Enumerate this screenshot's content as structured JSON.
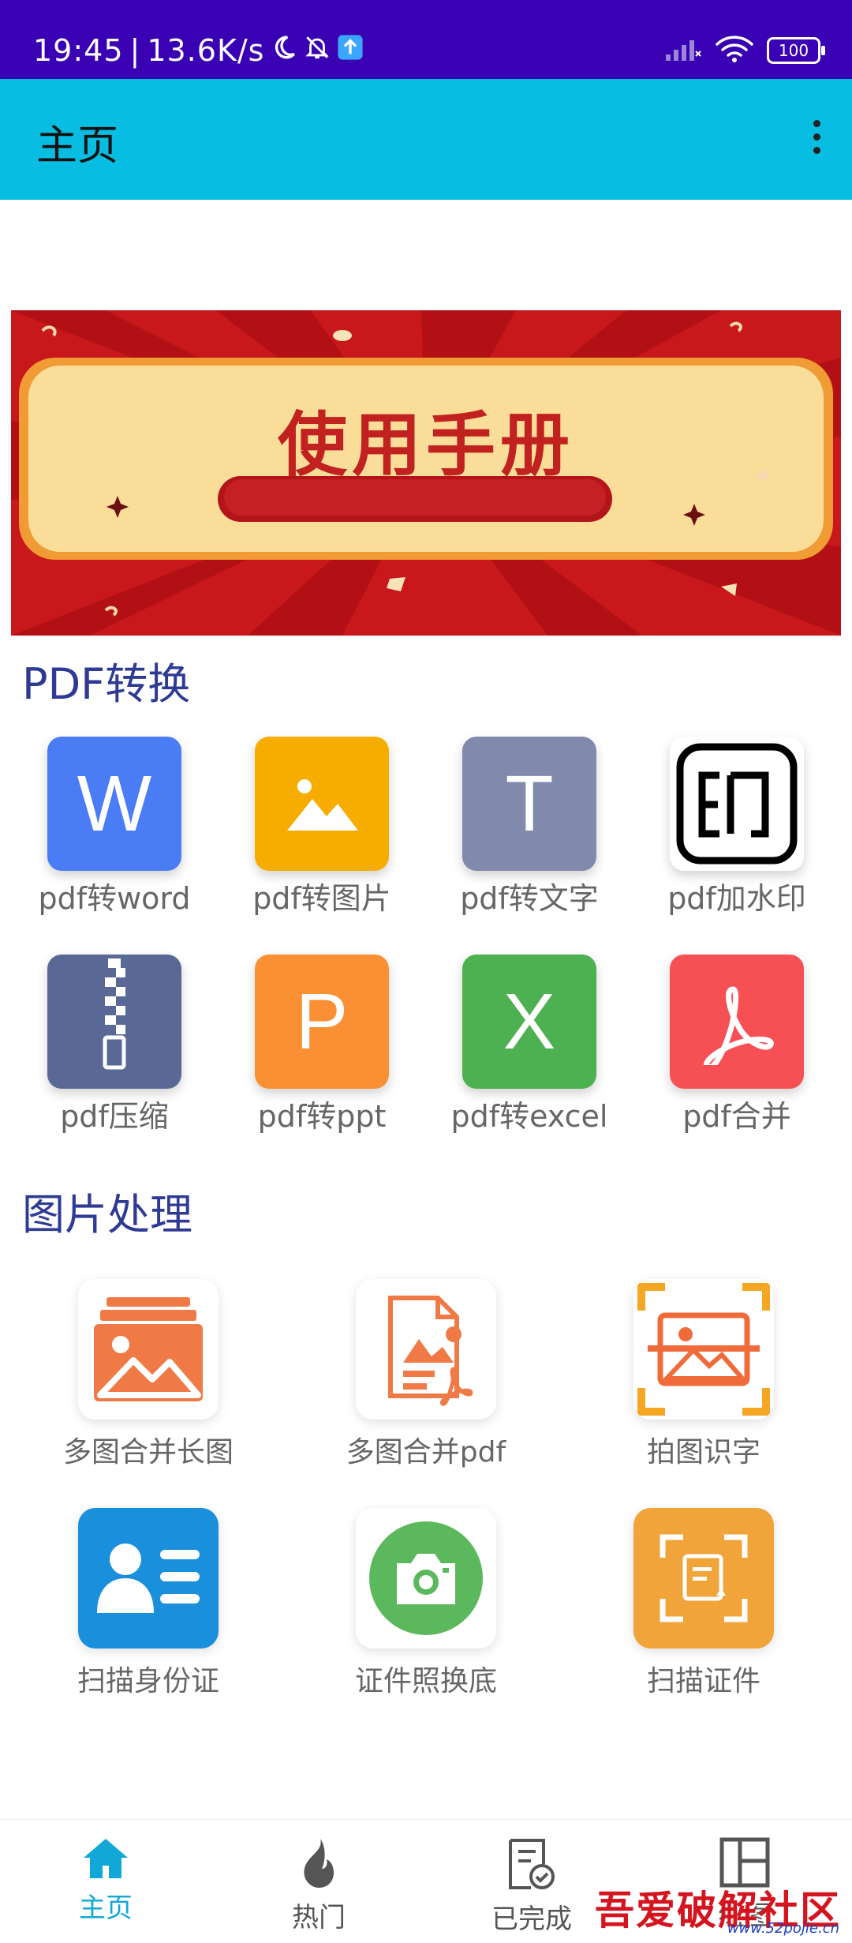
{
  "status_bar": {
    "time": "19:45",
    "speed": "13.6K/s",
    "battery": "100",
    "icons": [
      "moon-icon",
      "bell-off-icon",
      "upload-badge-icon",
      "signal-icon",
      "wifi-icon",
      "battery-icon"
    ]
  },
  "app_bar": {
    "title": "主页",
    "menu_icon": "more-vert-icon"
  },
  "banner": {
    "title": "使用手册"
  },
  "sections": {
    "pdf": {
      "title": "PDF转换",
      "items": [
        {
          "label": "pdf转word",
          "glyph": "W",
          "color": "#4a7cf6"
        },
        {
          "label": "pdf转图片",
          "glyph": "",
          "color": "#f6ad00"
        },
        {
          "label": "pdf转文字",
          "glyph": "T",
          "color": "#8189ad"
        },
        {
          "label": "pdf加水印",
          "glyph": "",
          "color": "#ffffff"
        },
        {
          "label": "pdf压缩",
          "glyph": "",
          "color": "#5a6896"
        },
        {
          "label": "pdf转ppt",
          "glyph": "P",
          "color": "#fa8f33"
        },
        {
          "label": "pdf转excel",
          "glyph": "X",
          "color": "#4db051"
        },
        {
          "label": "pdf合并",
          "glyph": "",
          "color": "#f65055"
        }
      ]
    },
    "image": {
      "title": "图片处理",
      "items": [
        {
          "label": "多图合并长图"
        },
        {
          "label": "多图合并pdf"
        },
        {
          "label": "拍图识字"
        },
        {
          "label": "扫描身份证"
        },
        {
          "label": "证件照换底"
        },
        {
          "label": "扫描证件"
        }
      ]
    }
  },
  "bottom_nav": {
    "items": [
      {
        "label": "主页",
        "active": true
      },
      {
        "label": "热门",
        "active": false
      },
      {
        "label": "已完成",
        "active": false
      },
      {
        "label": "组图",
        "active": false
      }
    ],
    "active_color": "#11a8d8"
  },
  "watermark": {
    "text": "吾爱破解社区",
    "url": "www.52pojie.cn"
  }
}
